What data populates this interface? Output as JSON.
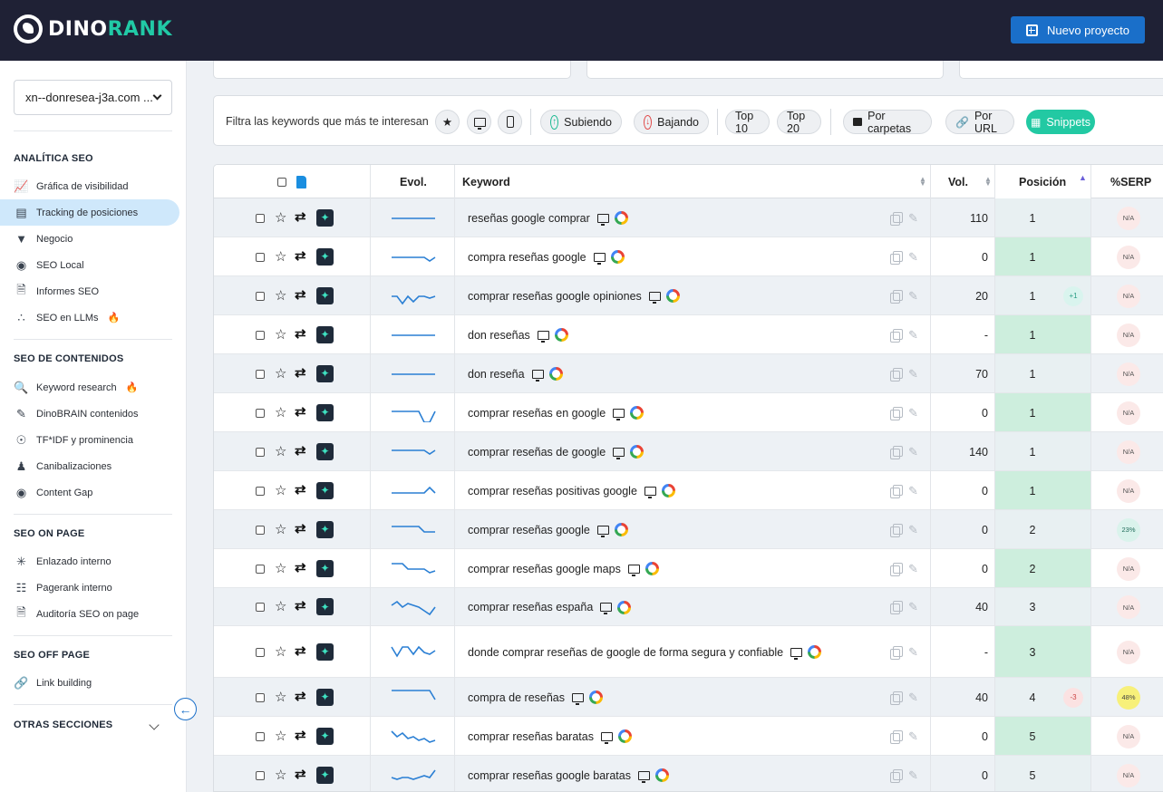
{
  "app": {
    "logo_part1": "DINO",
    "logo_part2": "RANK",
    "new_project_label": "Nuevo proyecto"
  },
  "sidebar": {
    "project_select": "xn--donresea-j3a.com ...",
    "sections": [
      {
        "title": "ANALÍTICA SEO",
        "items": [
          {
            "label": "Gráfica de visibilidad",
            "icon": "visibility-chart-icon"
          },
          {
            "label": "Tracking de posiciones",
            "icon": "bar-chart-icon",
            "active": true
          },
          {
            "label": "Negocio",
            "icon": "funnel-icon"
          },
          {
            "label": "SEO Local",
            "icon": "map-pin-icon"
          },
          {
            "label": "Informes SEO",
            "icon": "pdf-icon"
          },
          {
            "label": "SEO en LLMs",
            "icon": "dots-icon",
            "badge": "fire-icon"
          }
        ]
      },
      {
        "title": "SEO DE CONTENIDOS",
        "items": [
          {
            "label": "Keyword research",
            "icon": "keyword-search-icon",
            "badge": "fire-icon"
          },
          {
            "label": "DinoBRAIN contenidos",
            "icon": "pen-icon"
          },
          {
            "label": "TF*IDF y prominencia",
            "icon": "radar-icon"
          },
          {
            "label": "Canibalizaciones",
            "icon": "cannibal-icon"
          },
          {
            "label": "Content Gap",
            "icon": "eye-icon"
          }
        ]
      },
      {
        "title": "SEO ON PAGE",
        "items": [
          {
            "label": "Enlazado interno",
            "icon": "network-icon"
          },
          {
            "label": "Pagerank interno",
            "icon": "hierarchy-icon"
          },
          {
            "label": "Auditoría SEO on page",
            "icon": "audit-icon"
          }
        ]
      },
      {
        "title": "SEO OFF PAGE",
        "items": [
          {
            "label": "Link building",
            "icon": "link-icon"
          }
        ]
      }
    ],
    "other_sections": "OTRAS SECCIONES"
  },
  "filters": {
    "label": "Filtra las keywords que más te interesan",
    "subiendo": "Subiendo",
    "bajando": "Bajando",
    "top10": "Top 10",
    "top20": "Top 20",
    "carpetas": "Por carpetas",
    "url": "Por URL",
    "snippets": "Snippets"
  },
  "table": {
    "headers": {
      "evol": "Evol.",
      "keyword": "Keyword",
      "vol": "Vol.",
      "pos": "Posición",
      "serp": "%SERP"
    },
    "rows": [
      {
        "keyword": "reseñas google comprar",
        "vol": "110",
        "pos": "1",
        "chg": "",
        "serp": "N/A",
        "spark": [
          10,
          10,
          10,
          10,
          10,
          10,
          10,
          10
        ]
      },
      {
        "keyword": "compra reseñas google",
        "vol": "0",
        "pos": "1",
        "chg": "",
        "serp": "N/A",
        "spark": [
          10,
          10,
          10,
          10,
          10,
          10,
          10,
          14,
          10
        ]
      },
      {
        "keyword": "comprar reseñas google opiniones",
        "vol": "20",
        "pos": "1",
        "chg": "+1",
        "serp": "N/A",
        "spark": [
          10,
          10,
          18,
          10,
          16,
          10,
          10,
          12,
          10
        ]
      },
      {
        "keyword": "don reseñas",
        "vol": "-",
        "pos": "1",
        "chg": "",
        "serp": "N/A",
        "spark": [
          10,
          10,
          10,
          10,
          10,
          10,
          10,
          10
        ]
      },
      {
        "keyword": "don reseña",
        "vol": "70",
        "pos": "1",
        "chg": "",
        "serp": "N/A",
        "spark": [
          10,
          10,
          10,
          10,
          10,
          10,
          10,
          10
        ]
      },
      {
        "keyword": "comprar reseñas en google",
        "vol": "0",
        "pos": "1",
        "chg": "",
        "serp": "N/A",
        "spark": [
          8,
          8,
          8,
          8,
          8,
          8,
          20,
          20,
          8
        ]
      },
      {
        "keyword": "comprar reseñas de google",
        "vol": "140",
        "pos": "1",
        "chg": "",
        "serp": "N/A",
        "spark": [
          8,
          8,
          8,
          8,
          8,
          8,
          8,
          12,
          8
        ]
      },
      {
        "keyword": "comprar reseñas positivas google",
        "vol": "0",
        "pos": "1",
        "chg": "",
        "serp": "N/A",
        "spark": [
          12,
          12,
          12,
          12,
          12,
          12,
          12,
          6,
          12
        ]
      },
      {
        "keyword": "comprar reseñas google",
        "vol": "0",
        "pos": "2",
        "chg": "",
        "serp": "23%",
        "serpType": "pct",
        "spark": [
          6,
          6,
          6,
          6,
          6,
          6,
          12,
          12,
          12
        ]
      },
      {
        "keyword": "comprar reseñas google maps",
        "vol": "0",
        "pos": "2",
        "chg": "",
        "serp": "N/A",
        "spark": [
          4,
          4,
          4,
          10,
          10,
          10,
          10,
          14,
          12
        ]
      },
      {
        "keyword": "comprar reseñas españa",
        "vol": "40",
        "pos": "3",
        "chg": "",
        "serp": "N/A",
        "spark": [
          8,
          4,
          10,
          6,
          8,
          10,
          14,
          18,
          10
        ]
      },
      {
        "keyword": "donde comprar reseñas de google de forma segura y confiable",
        "vol": "-",
        "pos": "3",
        "chg": "",
        "serp": "N/A",
        "spark": [
          4,
          14,
          4,
          4,
          12,
          4,
          10,
          12,
          8
        ]
      },
      {
        "keyword": "compra de reseñas",
        "vol": "40",
        "pos": "4",
        "chg": "-3",
        "serp": "48%",
        "serpType": "hi",
        "spark": [
          2,
          2,
          2,
          2,
          2,
          2,
          2,
          2,
          12
        ]
      },
      {
        "keyword": "comprar reseñas baratas",
        "vol": "0",
        "pos": "5",
        "chg": "",
        "serp": "N/A",
        "spark": [
          4,
          10,
          6,
          12,
          10,
          14,
          12,
          16,
          14
        ]
      },
      {
        "keyword": "comprar reseñas google baratas",
        "vol": "0",
        "pos": "5",
        "chg": "",
        "serp": "N/A",
        "spark": [
          12,
          14,
          12,
          12,
          14,
          12,
          10,
          12,
          4
        ]
      }
    ]
  }
}
